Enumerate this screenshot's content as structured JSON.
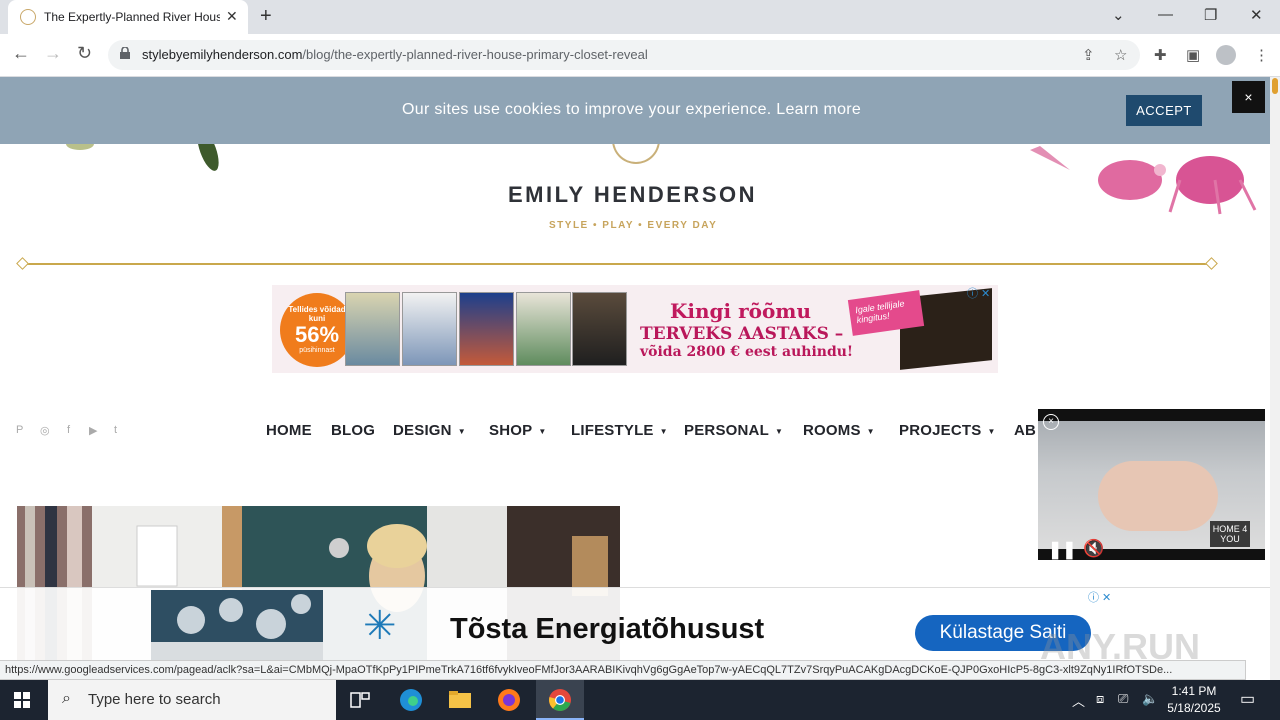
{
  "browser": {
    "tab_title": "The Expertly-Planned River House",
    "url_host": "stylebyemilyhenderson.com",
    "url_path": "/blog/the-expertly-planned-river-house-primary-closet-reveal"
  },
  "cookie_banner": {
    "message": "Our sites use cookies to improve your experience. Learn more",
    "accept_label": "ACCEPT",
    "close_label": "×"
  },
  "site": {
    "brand": "EMILY HENDERSON",
    "tagline": "STYLE  •  PLAY  •  EVERY DAY"
  },
  "ad_top": {
    "badge_line1": "Tellides võidad kuni",
    "badge_pct": "56%",
    "badge_line3": "püsihinnast",
    "headline": "Kingi rõõmu",
    "sub1": "TERVEKS AASTAKS –",
    "sub2": "võida 2800 € eest auhindu!",
    "promo": "Igale tellijale kingitus!"
  },
  "nav": {
    "items": [
      {
        "label": "HOME",
        "caret": false
      },
      {
        "label": "BLOG",
        "caret": false
      },
      {
        "label": "DESIGN",
        "caret": true
      },
      {
        "label": "SHOP",
        "caret": true
      },
      {
        "label": "LIFESTYLE",
        "caret": true
      },
      {
        "label": "PERSONAL",
        "caret": true
      },
      {
        "label": "ROOMS",
        "caret": true
      },
      {
        "label": "PROJECTS",
        "caret": true
      },
      {
        "label": "AB",
        "caret": false
      }
    ],
    "caret_glyph": "▼"
  },
  "social": {
    "icons": [
      "pinterest-icon",
      "instagram-icon",
      "facebook-icon",
      "youtube-icon",
      "twitter-icon"
    ],
    "glyphs": [
      "P",
      "◎",
      "f",
      "▶",
      "t"
    ]
  },
  "video": {
    "logo_text": "HOME 4 YOU",
    "close_glyph": "×",
    "pause_glyph": "❚❚",
    "mute_glyph": "🔇"
  },
  "ad_bottom": {
    "headline": "Tõsta Energiatõhusust",
    "cta": "Külastage Saiti",
    "logo_glyph": "✳",
    "watermark": "ANY.RUN"
  },
  "status_url": "https://www.googleadservices.com/pagead/aclk?sa=L&ai=CMbMQj-MpaOTfKpPy1PIPmeTrkA716tf6fvykIveoFMfJor3AARABIKivqhVg6gGgAeTop7w-yAECqQL7TZv7SrqyPuACAKgDAcgDCKoE-QJP0GxoHIcP5-8gC3-xlt9ZqNy1IRfOTSDe...",
  "taskbar": {
    "search_placeholder": "Type here to search",
    "time": "1:41 PM",
    "date": "5/18/2025"
  },
  "colors": {
    "accent_gold": "#c9a84c",
    "cookie_bar": "#8fa4b5",
    "accept_btn": "#1f4a6e",
    "ad_magenta": "#c0195d",
    "cta_blue": "#1565c0"
  }
}
